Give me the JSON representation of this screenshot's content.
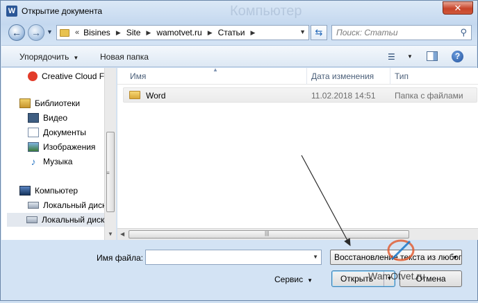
{
  "window": {
    "title": "Открытие документа",
    "ghost_title": "Компьютер"
  },
  "nav": {
    "breadcrumb_prefix": "«",
    "breadcrumbs": [
      "Bisines",
      "Site",
      "wamotvet.ru",
      "Статьи"
    ],
    "search_placeholder": "Поиск: Статьи"
  },
  "toolbar": {
    "organize_label": "Упорядочить",
    "new_folder_label": "Новая папка"
  },
  "sidebar": {
    "items": [
      {
        "label": "Creative Cloud Fi",
        "icon": "creative-cloud-icon"
      },
      {
        "label": "Библиотеки",
        "icon": "libraries-icon"
      },
      {
        "label": "Видео",
        "icon": "video-icon"
      },
      {
        "label": "Документы",
        "icon": "documents-icon"
      },
      {
        "label": "Изображения",
        "icon": "pictures-icon"
      },
      {
        "label": "Музыка",
        "icon": "music-icon"
      },
      {
        "label": "Компьютер",
        "icon": "computer-icon"
      },
      {
        "label": "Локальный диск",
        "icon": "disk-icon"
      },
      {
        "label": "Локальный диск",
        "icon": "disk-icon"
      }
    ]
  },
  "filelist": {
    "columns": {
      "name": "Имя",
      "date": "Дата изменения",
      "type": "Тип"
    },
    "rows": [
      {
        "name": "Word",
        "date": "11.02.2018 14:51",
        "type": "Папка с файлами"
      }
    ]
  },
  "footer": {
    "filename_label": "Имя файла:",
    "filename_value": "",
    "filetype_value": "Восстановление текста из любого файла",
    "tools_label": "Сервис",
    "open_label": "Открыть",
    "cancel_label": "Отмена"
  },
  "watermark": {
    "text": "WamOtvet.ru"
  },
  "colors": {
    "close_button": "#c7442a",
    "chrome": "#c4d8ef"
  }
}
